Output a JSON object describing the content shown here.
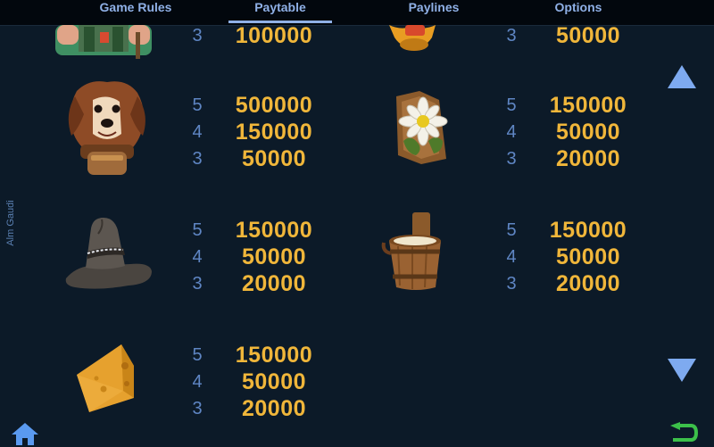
{
  "tabs": [
    {
      "label": "Game Rules",
      "active": false
    },
    {
      "label": "Paytable",
      "active": true
    },
    {
      "label": "Paylines",
      "active": false
    },
    {
      "label": "Options",
      "active": false
    }
  ],
  "side_label": "Alm Gaudi",
  "paytable": {
    "farmer": [
      {
        "count": "3",
        "value": "100000"
      }
    ],
    "bell": [
      {
        "count": "3",
        "value": "50000"
      }
    ],
    "dog": [
      {
        "count": "5",
        "value": "500000"
      },
      {
        "count": "4",
        "value": "150000"
      },
      {
        "count": "3",
        "value": "50000"
      }
    ],
    "edelweiss": [
      {
        "count": "5",
        "value": "150000"
      },
      {
        "count": "4",
        "value": "50000"
      },
      {
        "count": "3",
        "value": "20000"
      }
    ],
    "hat": [
      {
        "count": "5",
        "value": "150000"
      },
      {
        "count": "4",
        "value": "50000"
      },
      {
        "count": "3",
        "value": "20000"
      }
    ],
    "bucket": [
      {
        "count": "5",
        "value": "150000"
      },
      {
        "count": "4",
        "value": "50000"
      },
      {
        "count": "3",
        "value": "20000"
      }
    ],
    "cheese": [
      {
        "count": "5",
        "value": "150000"
      },
      {
        "count": "4",
        "value": "50000"
      },
      {
        "count": "3",
        "value": "20000"
      }
    ]
  },
  "colors": {
    "background": "#0c1a28",
    "tab_text": "#8fb0e6",
    "count_text": "#5f86c4",
    "value_text": "#f0b63a",
    "arrow": "#7eaaf0",
    "home": "#5a9af0",
    "back": "#3cc04a"
  },
  "icons": {
    "scroll_up": "up-arrow-icon",
    "scroll_down": "down-arrow-icon",
    "home": "home-icon",
    "back": "back-icon"
  }
}
